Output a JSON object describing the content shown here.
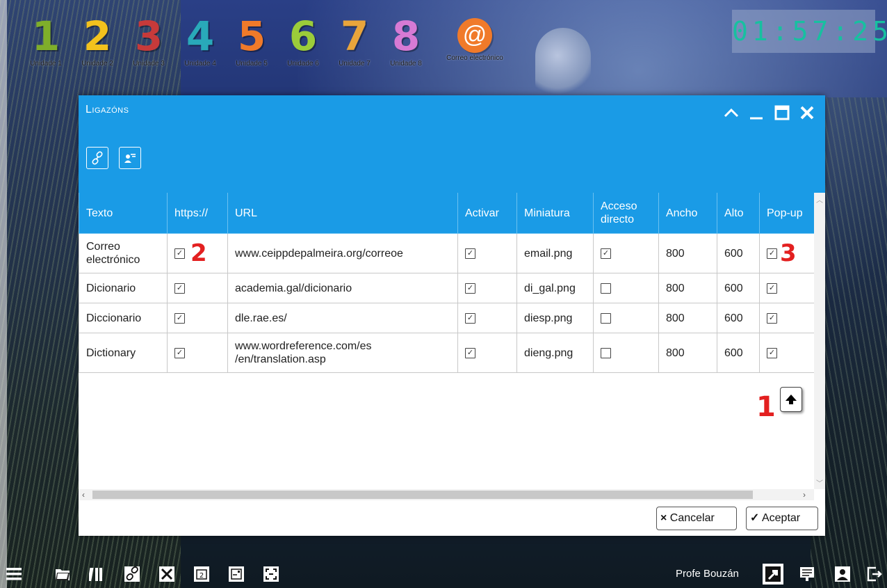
{
  "units": [
    {
      "num": "1",
      "label": "Unidade 1",
      "color": "#7fae2a"
    },
    {
      "num": "2",
      "label": "Unidade 2",
      "color": "#f3c21d"
    },
    {
      "num": "3",
      "label": "Unidade 3",
      "color": "#c73a3a"
    },
    {
      "num": "4",
      "label": "Unidade 4",
      "color": "#29a9b9"
    },
    {
      "num": "5",
      "label": "Unidade 5",
      "color": "#f07a2a"
    },
    {
      "num": "6",
      "label": "Unidade 6",
      "color": "#9bcc3a"
    },
    {
      "num": "7",
      "label": "Unidade 7",
      "color": "#e9a53b"
    },
    {
      "num": "8",
      "label": "Unidade 8",
      "color": "#d77ad4"
    }
  ],
  "mail": {
    "symbol": "@",
    "label": "Correo electrónico"
  },
  "clock": "01:57:25",
  "dialog": {
    "title": "Ligazóns",
    "columns": [
      "Texto",
      "https://",
      "URL",
      "Activar",
      "Miniatura",
      "Acceso directo",
      "Ancho",
      "Alto",
      "Pop-up"
    ],
    "rows": [
      {
        "texto": "Correo electrónico",
        "https": true,
        "url": "www.ceippdepalmeira.org/correoe",
        "activar": true,
        "miniatura": "email.png",
        "acceso": true,
        "ancho": "800",
        "alto": "600",
        "popup": true
      },
      {
        "texto": "Dicionario",
        "https": true,
        "url": "academia.gal/dicionario",
        "activar": true,
        "miniatura": "di_gal.png",
        "acceso": false,
        "ancho": "800",
        "alto": "600",
        "popup": true
      },
      {
        "texto": "Diccionario",
        "https": true,
        "url": "dle.rae.es/",
        "activar": true,
        "miniatura": "diesp.png",
        "acceso": false,
        "ancho": "800",
        "alto": "600",
        "popup": true
      },
      {
        "texto": "Dictionary",
        "https": true,
        "url": "www.wordreference.com/es /en/translation.asp",
        "activar": true,
        "miniatura": "dieng.png",
        "acceso": false,
        "ancho": "800",
        "alto": "600",
        "popup": true
      }
    ],
    "markers": {
      "one": "1",
      "two": "2",
      "three": "3"
    },
    "cancel_label": "Cancelar",
    "accept_label": "Aceptar",
    "cancel_icon": "×",
    "accept_icon": "✓"
  },
  "footer": {
    "user_name": "Profe Bouzán"
  },
  "colors": {
    "header_blue": "#1a9be6",
    "marker_red": "#e32020"
  }
}
